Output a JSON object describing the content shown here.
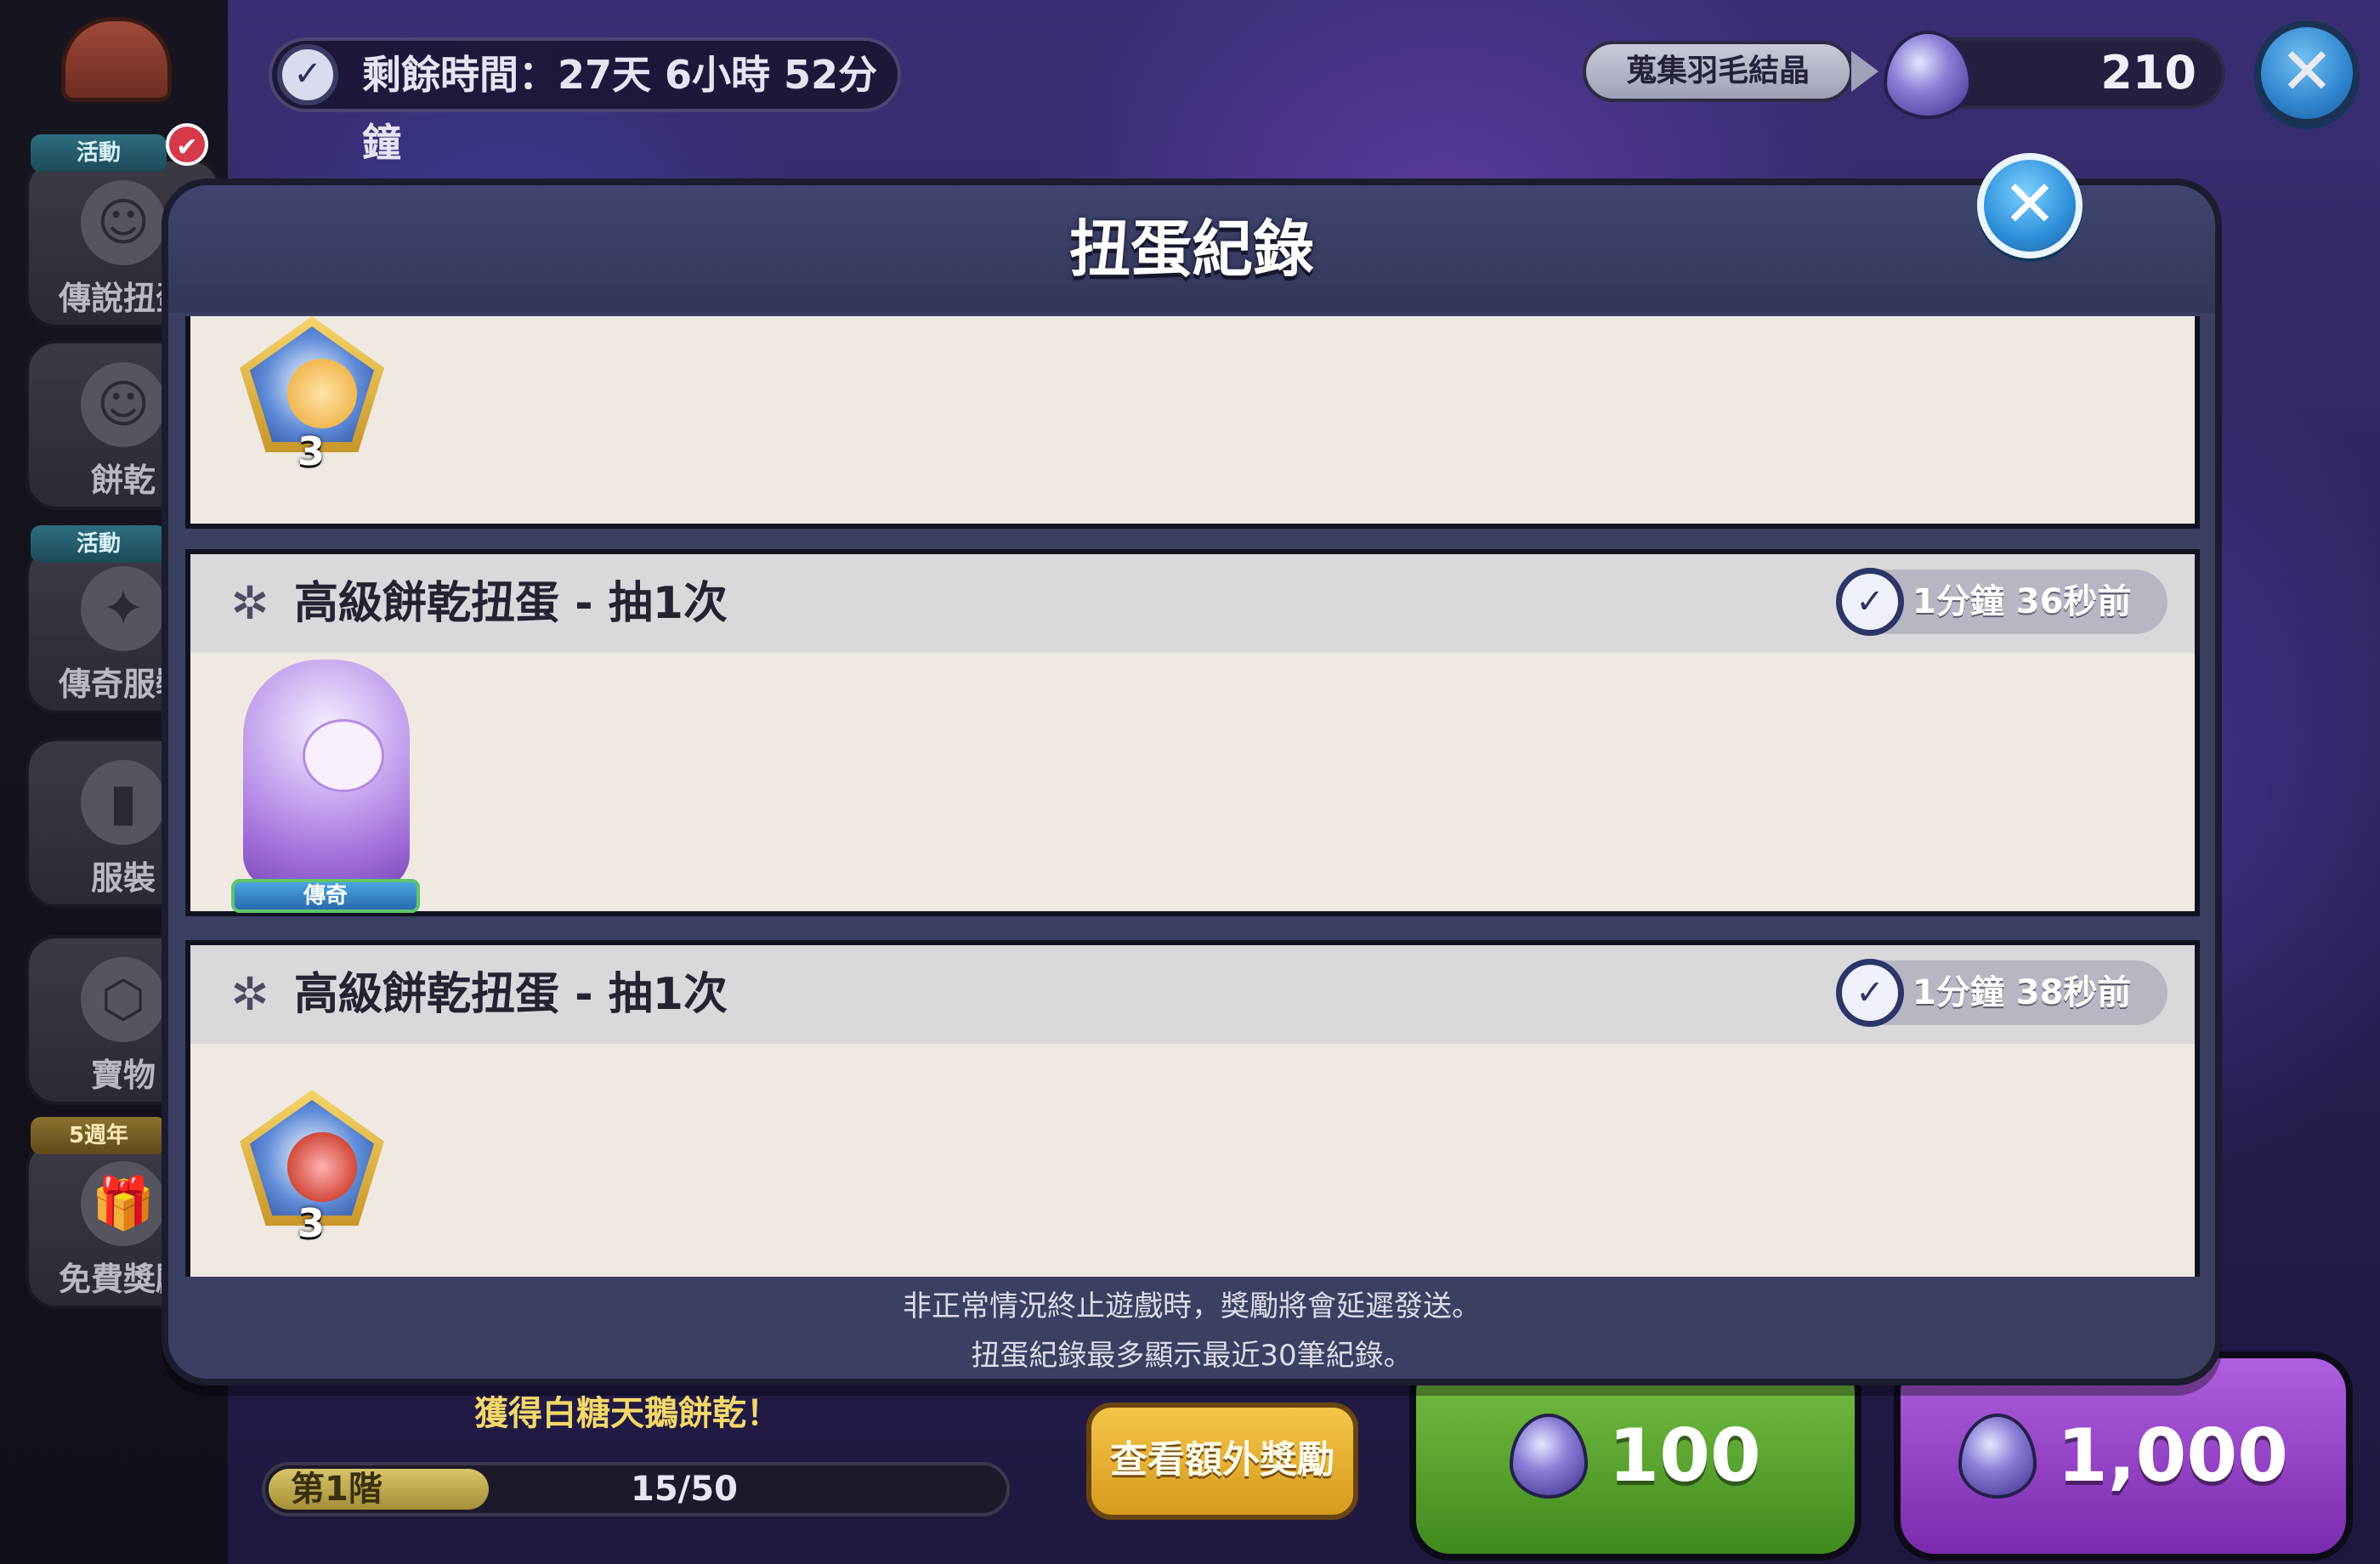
{
  "top_bar": {
    "timer_text": "剩餘時間：27天 6小時 52分鐘",
    "currency_tag": "蒐集羽毛結晶",
    "currency_amount": "210"
  },
  "sidebar": {
    "items": [
      {
        "ribbon": "活動",
        "label": "傳說扭蛋"
      },
      {
        "ribbon": "",
        "label": "餅乾"
      },
      {
        "ribbon": "活動",
        "label": "傳奇服裝"
      },
      {
        "ribbon": "",
        "label": "服裝"
      },
      {
        "ribbon": "",
        "label": "寶物"
      },
      {
        "ribbon": "5週年",
        "label": "免費獎勵"
      }
    ]
  },
  "bottom": {
    "reward_message": "獲得白糖天鵝餅乾！",
    "stage_label": "第1階",
    "stage_progress": "15/50",
    "stage_fraction": 0.3,
    "bonus_button": "查看額外獎勵",
    "buy_single": "100",
    "buy_ten": "1,000"
  },
  "modal": {
    "title": "扭蛋紀錄",
    "records": [
      {
        "title": "",
        "time": "",
        "item": {
          "type": "soulstone",
          "count": "3"
        }
      },
      {
        "title": "高級餅乾扭蛋 - 抽1次",
        "time": "1分鐘 36秒前",
        "item": {
          "type": "cookie",
          "rarity": "傳奇"
        }
      },
      {
        "title": "高級餅乾扭蛋 - 抽1次",
        "time": "1分鐘 38秒前",
        "item": {
          "type": "soulstone",
          "count": "3"
        }
      }
    ],
    "footer_lines": [
      "非正常情況終止遊戲時，獎勵將會延遲發送。",
      "扭蛋紀錄最多顯示最近30筆紀錄。"
    ]
  },
  "colors": {
    "modal_bg": "#3b3f62",
    "record_bg": "#f0e9e2",
    "record_header": "#d9d8db",
    "buy_single": "#4f9a28",
    "buy_ten": "#8a36c0",
    "close_button": "#2d8ed9"
  },
  "icons": {
    "timer": "clock-icon",
    "close": "close-icon",
    "record_type": "gingerbread-icon",
    "currency": "crystal-icon"
  }
}
